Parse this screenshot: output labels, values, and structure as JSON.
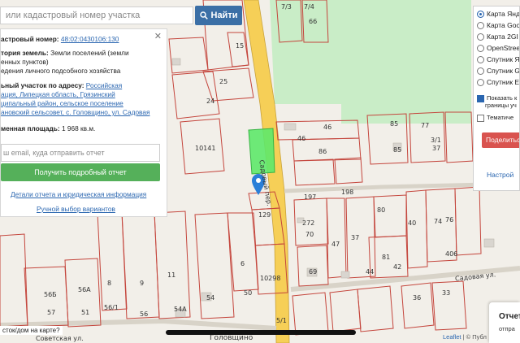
{
  "search": {
    "placeholder": "или кадастровый номер участка",
    "button_label": "Найти"
  },
  "info": {
    "cad_label": "астровый номер:",
    "cad_number": "48:02:0430106:130",
    "category_label": "тория земель:",
    "category_value_1": "Земли поселений (земли",
    "category_value_2": "енных пунктов)",
    "usage_value": "едения личного подсобного хозяйства",
    "address_label": "ьный участок по адресу:",
    "address_1": "Российская",
    "address_2": "ация, Липецкая область, Грязинский",
    "address_3": "ципальный район, сельское поселение",
    "address_4": "ановский сельсовет, с. Головщино, ул. Садовая",
    "area_label": "менная площадь:",
    "area_value": "1 968 кв.м.",
    "email_placeholder": "ш email, куда отправить отчет",
    "order_button": "Получить подробный отчет",
    "details_link": "Детали отчета и юридическая информация",
    "manual_link": "Ручной выбор вариантов"
  },
  "layers": {
    "options": [
      "Карта Янд",
      "Карта Goo",
      "Карта 2GI",
      "OpenStree",
      "Спутник Я",
      "Спутник G",
      "Спутник E"
    ],
    "selected_index": 0,
    "check_show_label_1": "Показать к",
    "check_show_label_2": "границы уч",
    "check_show_checked": true,
    "check_thematic_label": "Тематиче",
    "check_thematic_checked": false,
    "share_label": "Поделиться",
    "settings_link": "Настрой"
  },
  "map_labels": {
    "parcels": [
      "7/3",
      "7/4",
      "66",
      "15",
      "25",
      "24",
      "10141",
      "46",
      "46",
      "86",
      "85",
      "85",
      "77",
      "3/1",
      "37",
      "197",
      "198",
      "129",
      "272",
      "70",
      "80",
      "40",
      "74",
      "76",
      "47",
      "37",
      "6",
      "10298",
      "50",
      "69",
      "44",
      "81",
      "42",
      "406",
      "36",
      "33",
      "8",
      "9",
      "11",
      "56А",
      "56Б",
      "56/1",
      "56",
      "54А",
      "54",
      "57",
      "51",
      "5/1"
    ],
    "streets": [
      "Садовый пер.",
      "Садовая ул.",
      "Советская ул.",
      "Головщино"
    ]
  },
  "bottom": {
    "question": "сток/дом на карте?",
    "attribution_leaflet": "Leaflet",
    "attribution_rest": "| © Публ"
  },
  "report": {
    "title": "Отчет",
    "subtitle": "отпра"
  },
  "colors": {
    "selected_parcel": "#5ee86a",
    "green_area": "#c9edc7",
    "road": "#f6cf57",
    "parcel_border": "#c4453c",
    "accent": "#3b6fa6",
    "order_button": "#55b05a",
    "share_button": "#d9534f",
    "marker": "#2a7fd8"
  }
}
